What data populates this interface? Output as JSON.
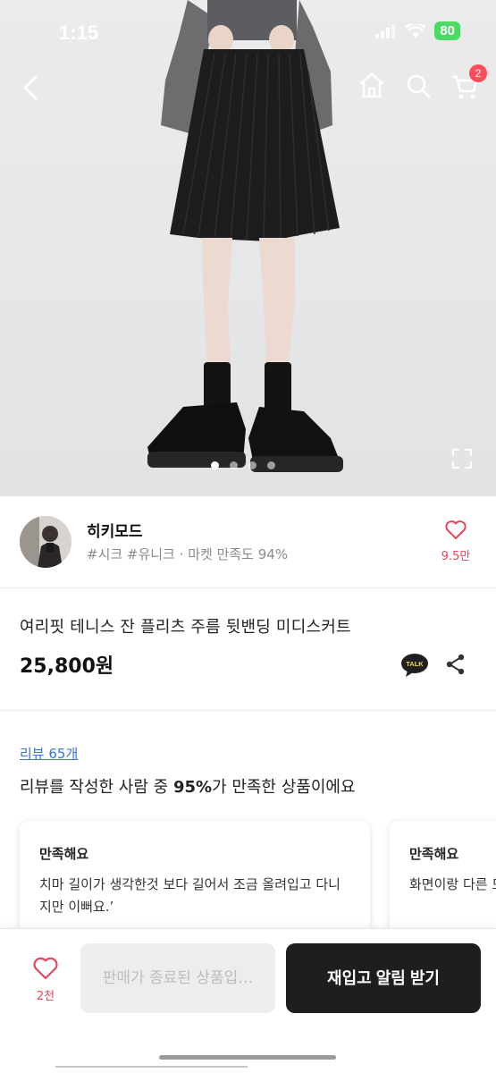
{
  "status_bar": {
    "time": "1:15",
    "battery": "80"
  },
  "nav": {
    "cart_count": "2"
  },
  "gallery": {
    "total_images": 4,
    "active_index": 0
  },
  "shop": {
    "name": "히키모드",
    "tags": "#시크 #유니크 · 마켓 만족도 94%",
    "like_count": "9.5만"
  },
  "product": {
    "title": "여리핏 테니스 잔 플리츠 주름 뒷밴딩 미디스커트",
    "price": "25,800원",
    "talk_label": "TALK"
  },
  "reviews": {
    "link": "리뷰 65개",
    "summary_prefix": "리뷰를 작성한 사람 중 ",
    "summary_percent": "95%",
    "summary_suffix": "가 만족한 상품이에요",
    "cards": [
      {
        "title": "만족해요",
        "body": "치마 길이가 생각한것 보다 길어서 조금 올려입고 다니지만 이뻐요.ʼ"
      },
      {
        "title": "만족해요",
        "body": "화면이랑 다른 모델분과 피지"
      }
    ]
  },
  "bottom_bar": {
    "wish_count": "2천",
    "sold_out_label": "판매가 종료된 상품입…",
    "restock_label": "재입고 알림 받기"
  },
  "colors": {
    "accent_red": "#e0485b",
    "link_blue": "#3a74d6",
    "dark_button": "#1e1e1e"
  }
}
